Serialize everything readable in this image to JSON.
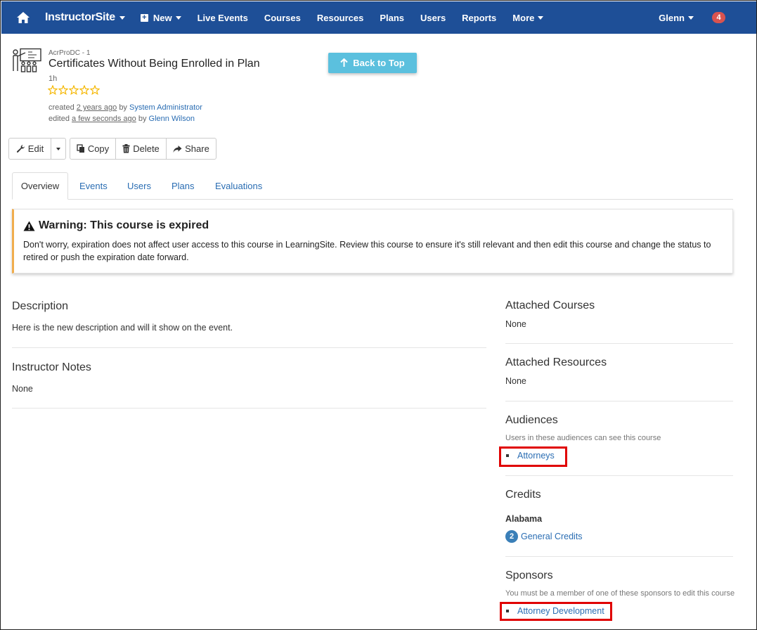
{
  "nav": {
    "brand": "InstructorSite",
    "items": [
      {
        "label": "New",
        "dropdown": true,
        "plus": true
      },
      {
        "label": "Live Events"
      },
      {
        "label": "Courses"
      },
      {
        "label": "Resources"
      },
      {
        "label": "Plans"
      },
      {
        "label": "Users"
      },
      {
        "label": "Reports"
      },
      {
        "label": "More",
        "dropdown": true
      }
    ],
    "user": "Glenn",
    "badge": "4"
  },
  "course": {
    "code": "AcrProDC - 1",
    "title": "Certificates Without Being Enrolled in Plan",
    "duration": "1h",
    "rating": 0,
    "created_prefix": "created",
    "created_when": "2 years ago",
    "created_by_prefix": "by",
    "created_by": "System Administrator",
    "edited_prefix": "edited",
    "edited_when": "a few seconds ago",
    "edited_by_prefix": "by",
    "edited_by": "Glenn Wilson"
  },
  "back_to_top": "Back to Top",
  "toolbar": {
    "edit": "Edit",
    "copy": "Copy",
    "delete": "Delete",
    "share": "Share"
  },
  "tabs": [
    "Overview",
    "Events",
    "Users",
    "Plans",
    "Evaluations"
  ],
  "warning": {
    "title": "Warning: This course is expired",
    "text": "Don't worry, expiration does not affect user access to this course in LearningSite. Review this course to ensure it's still relevant and then edit this course and change the status to retired or push the expiration date forward."
  },
  "left": {
    "description_title": "Description",
    "description_text": "Here is the new description and will it show on the event.",
    "notes_title": "Instructor Notes",
    "notes_text": "None"
  },
  "right": {
    "attached_courses_title": "Attached Courses",
    "attached_courses_text": "None",
    "attached_resources_title": "Attached Resources",
    "attached_resources_text": "None",
    "audiences_title": "Audiences",
    "audiences_sub": "Users in these audiences can see this course",
    "audiences": [
      "Attorneys"
    ],
    "credits_title": "Credits",
    "credits_state": "Alabama",
    "credits_count": "2",
    "credits_type": "General Credits",
    "sponsors_title": "Sponsors",
    "sponsors_sub": "You must be a member of one of these sponsors to edit this course",
    "sponsors": [
      "Attorney Development"
    ]
  },
  "colors": {
    "navbar": "#1e4f97",
    "link": "#2a6db3",
    "warning_accent": "#f0ad4e",
    "highlight": "#e00000",
    "star": "#f5b700"
  }
}
